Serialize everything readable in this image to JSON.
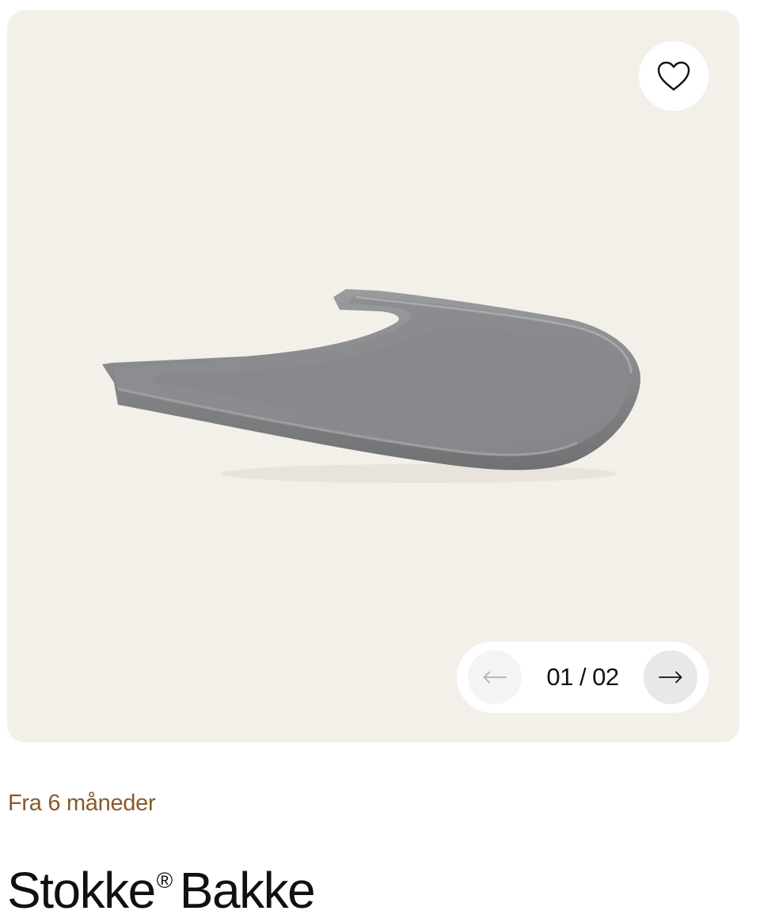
{
  "product": {
    "age_label": "Fra 6 måneder",
    "title_brand": "Stokke",
    "title_mark": "®",
    "title_name": "Bakke",
    "image_icon": "grey-tray-product-image"
  },
  "gallery": {
    "counter": "01 / 02",
    "prev_icon": "arrow-left-icon",
    "next_icon": "arrow-right-icon",
    "favorite_icon": "heart-icon",
    "background_color": "#f3f0ea"
  },
  "colors": {
    "age_label": "#8a5a2b",
    "tray": "#8a8c8e"
  }
}
